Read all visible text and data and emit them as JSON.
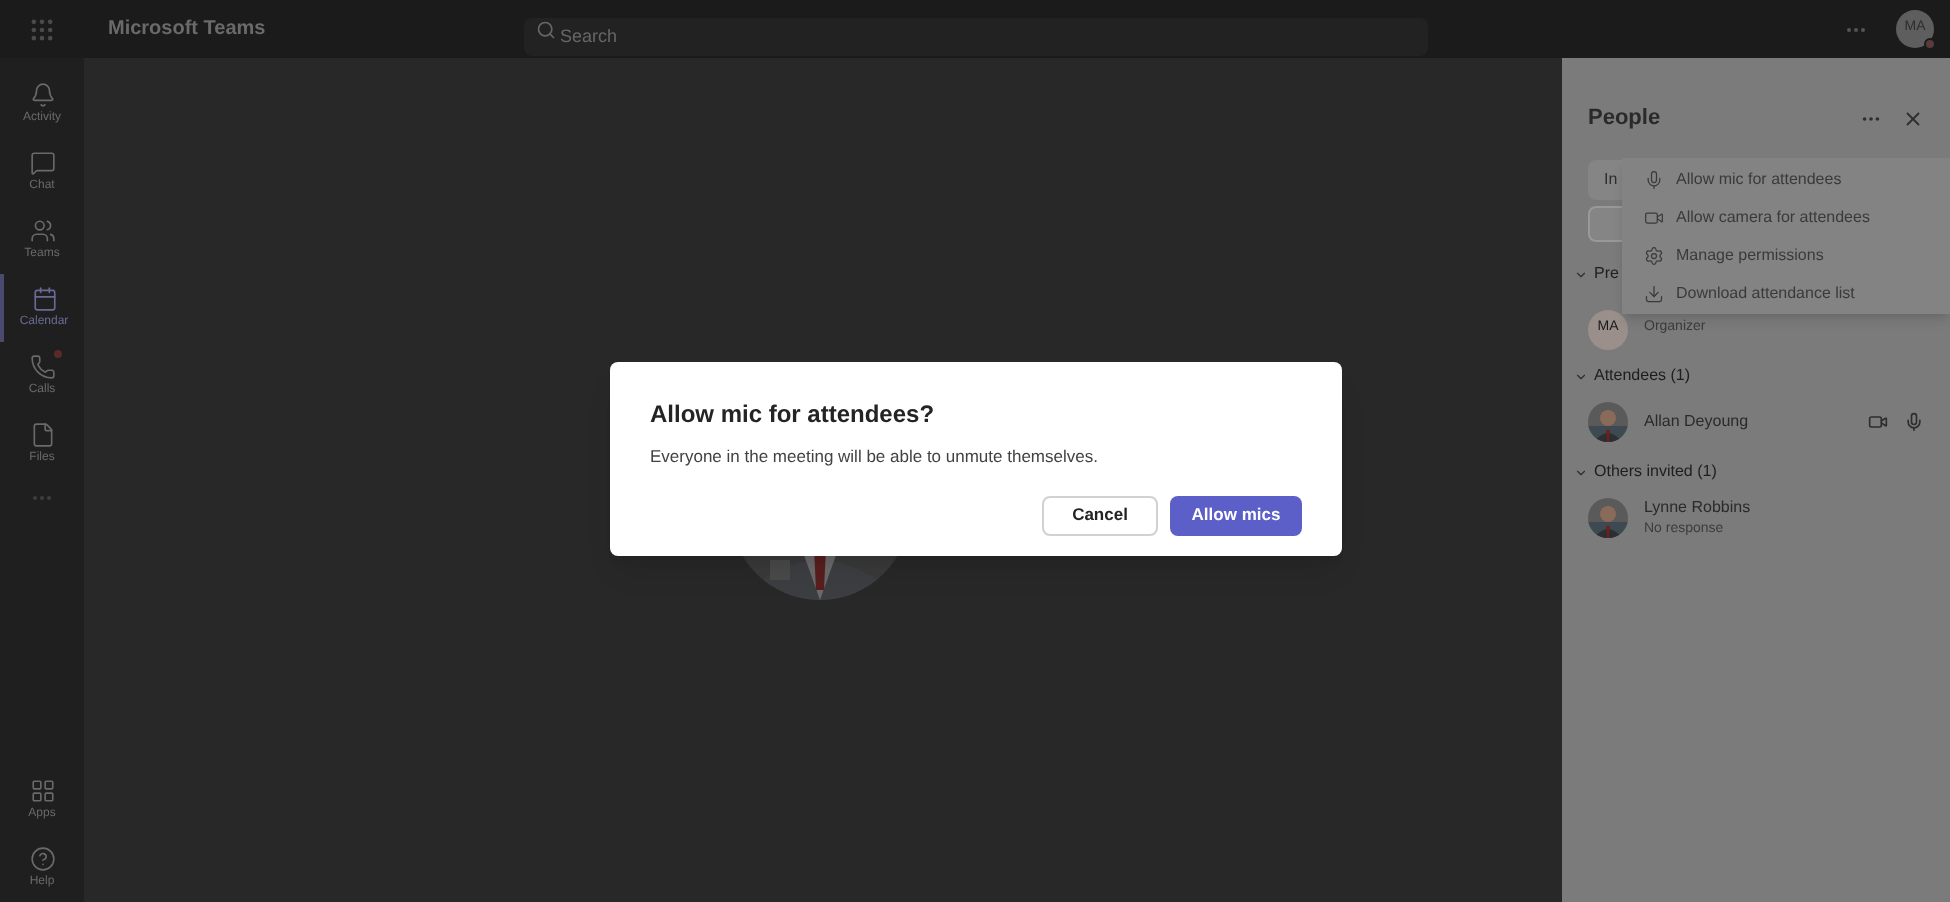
{
  "app": {
    "title": "Microsoft Teams",
    "search_placeholder": "Search",
    "avatar_initials": "MA"
  },
  "rail": [
    {
      "label": "Activity",
      "selected": false,
      "badge": false
    },
    {
      "label": "Chat",
      "selected": false,
      "badge": false
    },
    {
      "label": "Teams",
      "selected": false,
      "badge": false
    },
    {
      "label": "Calendar",
      "selected": true,
      "badge": false
    },
    {
      "label": "Calls",
      "selected": false,
      "badge": true
    },
    {
      "label": "Files",
      "selected": false,
      "badge": false
    }
  ],
  "rail_bottom": [
    {
      "label": "Apps"
    },
    {
      "label": "Help"
    }
  ],
  "people": {
    "title": "People",
    "invite_partial": "In",
    "sections": [
      {
        "label": "Pre",
        "members": [
          {
            "initials": "MA",
            "subtitle": "Organizer",
            "kind": "initials",
            "actions": false
          }
        ]
      },
      {
        "label": "Attendees (1)",
        "members": [
          {
            "name": "Allan Deyoung",
            "actions": true
          }
        ]
      },
      {
        "label": "Others invited (1)",
        "members": [
          {
            "name": "Lynne Robbins",
            "subtitle": "No response",
            "actions": false
          }
        ]
      }
    ]
  },
  "menu": [
    {
      "label": "Allow mic for attendees"
    },
    {
      "label": "Allow camera for attendees"
    },
    {
      "label": "Manage permissions"
    },
    {
      "label": "Download attendance list"
    }
  ],
  "dialog": {
    "title": "Allow mic for attendees?",
    "message": "Everyone in the meeting will be able to unmute themselves.",
    "cancel": "Cancel",
    "confirm": "Allow mics"
  }
}
